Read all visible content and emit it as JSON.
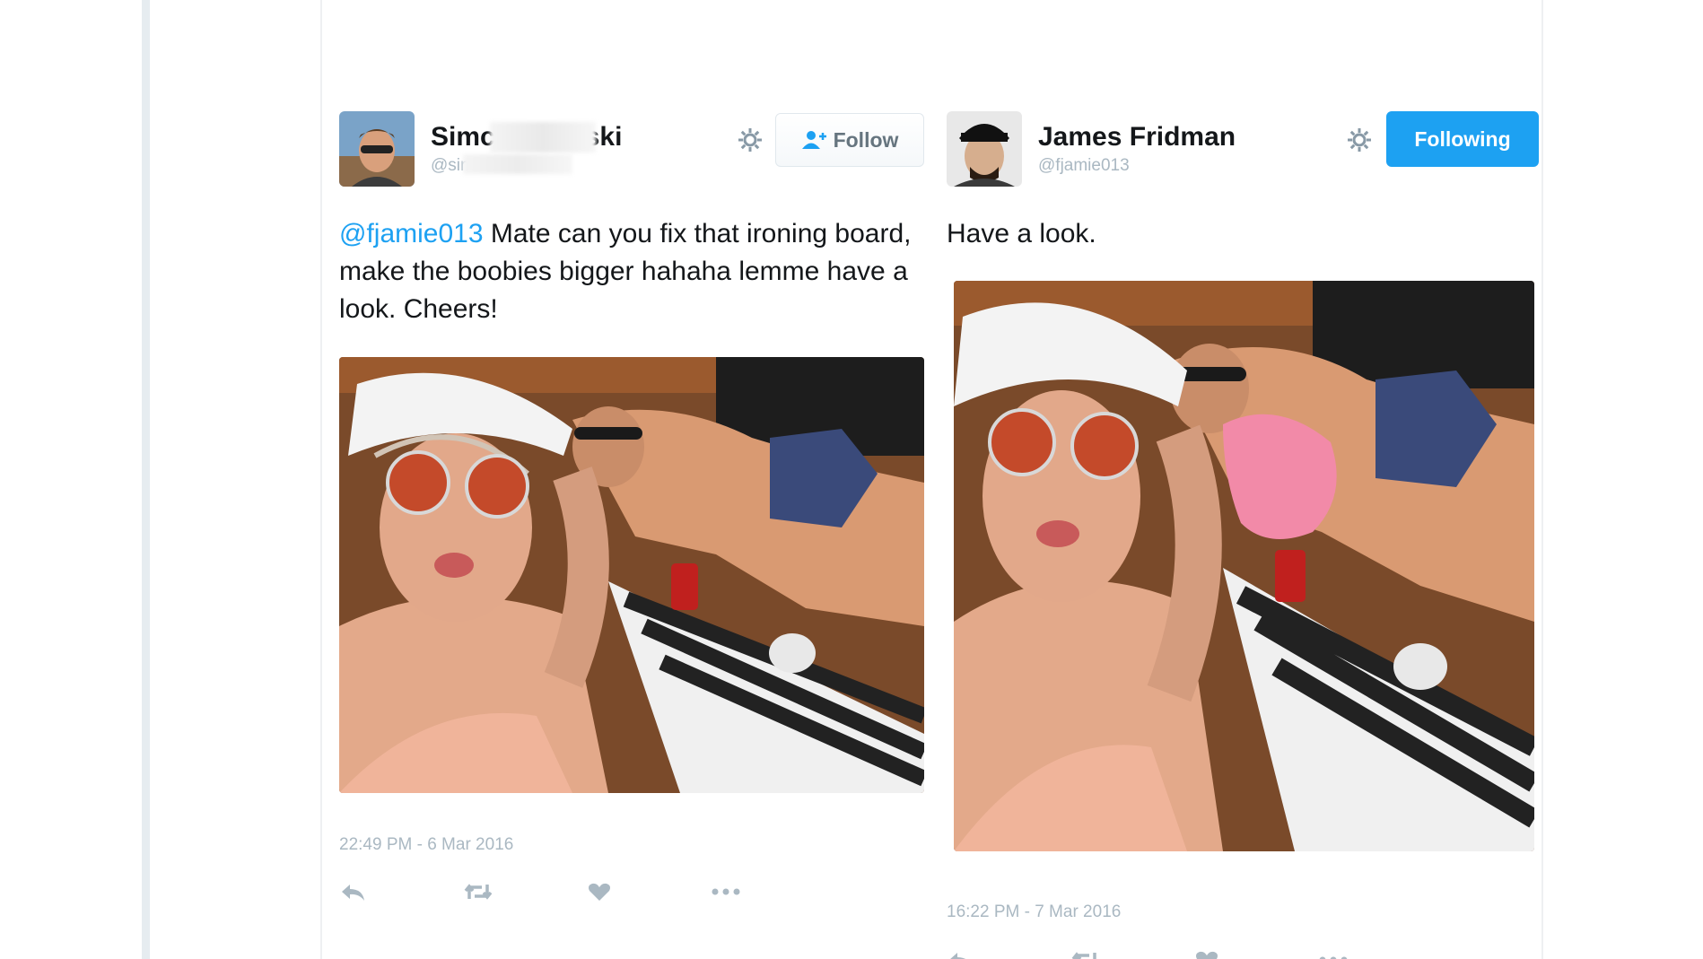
{
  "tweets": [
    {
      "name_start": "Simc",
      "name_end": "ski",
      "handle_start": "@sim",
      "follow_label": "Follow",
      "mention": "@fjamie013",
      "text": " Mate can you fix that ironing board, make the boobies bigger hahaha lemme have a look. Cheers!",
      "timestamp": "22:49 PM - 6 Mar 2016"
    },
    {
      "name": "James Fridman",
      "handle": "@fjamie013",
      "follow_label": "Following",
      "text": "Have a look.",
      "timestamp": "16:22 PM - 7 Mar 2016"
    }
  ],
  "colors": {
    "accent": "#1da1f2",
    "muted": "#aab8c2",
    "text": "#14171a"
  },
  "icons": [
    "gear-icon",
    "add-user-icon",
    "reply-icon",
    "retweet-icon",
    "like-icon",
    "more-icon"
  ]
}
